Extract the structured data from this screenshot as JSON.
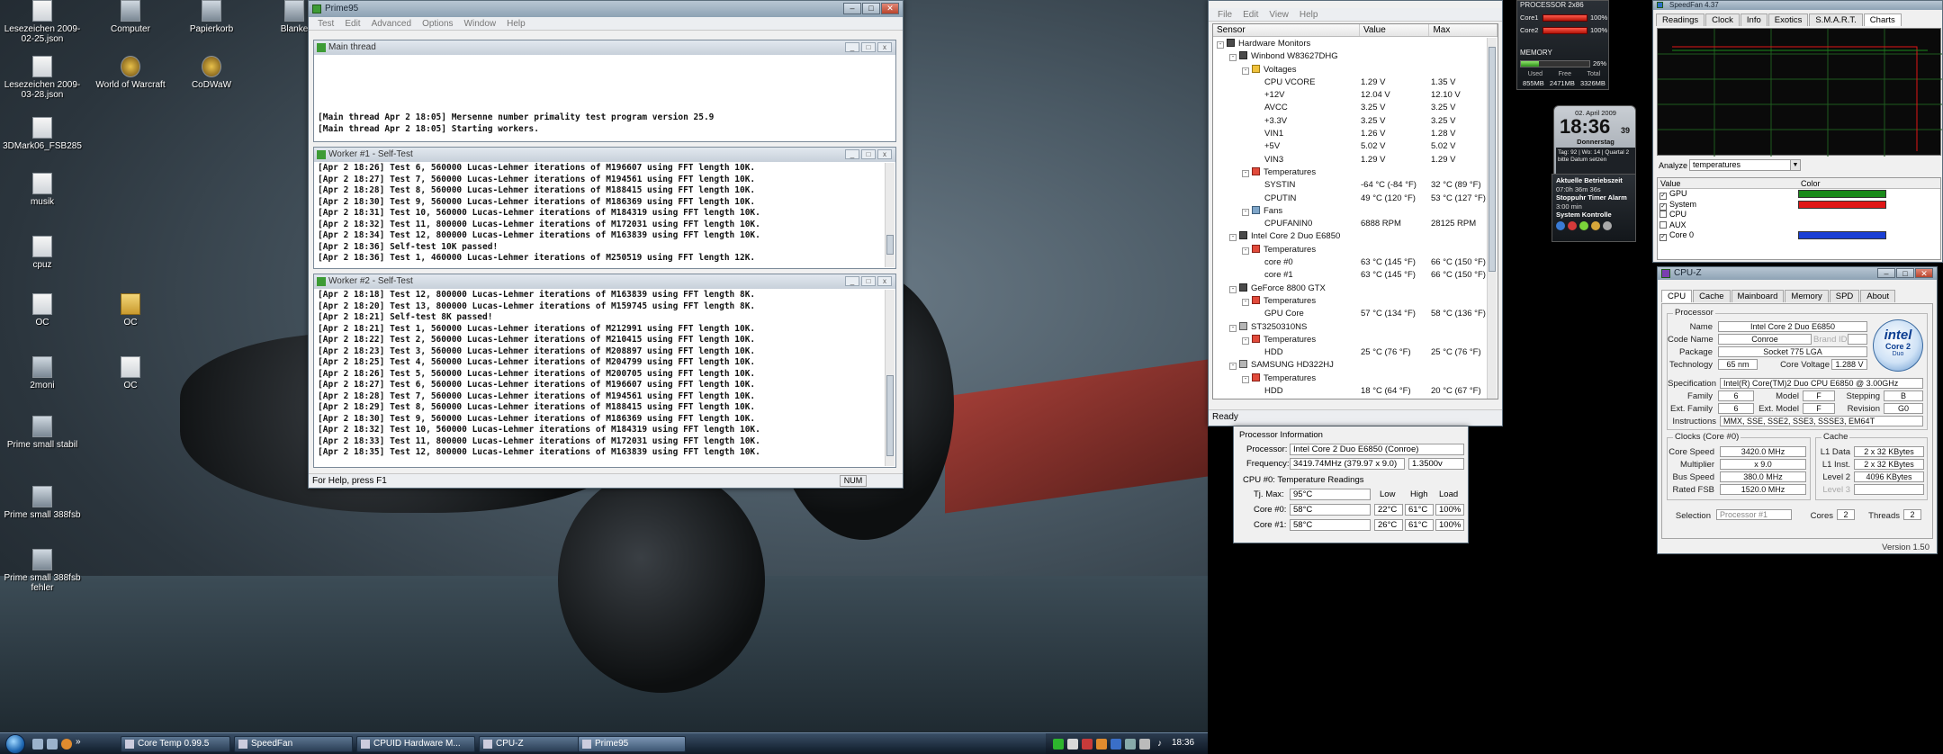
{
  "desktop": {
    "icons": [
      {
        "label": "Lesezeichen 2009-02-25.json",
        "kind": "doc"
      },
      {
        "label": "Computer",
        "kind": "prog"
      },
      {
        "label": "Papierkorb",
        "kind": "prog"
      },
      {
        "label": "Blanke",
        "kind": "prog"
      },
      {
        "label": "Lesezeichen 2009-03-28.json",
        "kind": "doc"
      },
      {
        "label": "World of Warcraft",
        "kind": "game"
      },
      {
        "label": "CoDWaW",
        "kind": "game"
      },
      {
        "label": "3DMark06_FSB285",
        "kind": "doc"
      },
      {
        "label": "musik",
        "kind": "doc"
      },
      {
        "label": "cpuz",
        "kind": "doc"
      },
      {
        "label": "OC",
        "kind": "doc"
      },
      {
        "label": "OC",
        "kind": "folder"
      },
      {
        "label": "2moni",
        "kind": "prog"
      },
      {
        "label": "OC",
        "kind": "doc"
      },
      {
        "label": "Prime small stabil",
        "kind": "prog"
      },
      {
        "label": "Prime small 388fsb",
        "kind": "prog"
      },
      {
        "label": "Prime small 388fsb fehler",
        "kind": "prog"
      }
    ]
  },
  "prime95": {
    "title": "Prime95",
    "menu": [
      "Test",
      "Edit",
      "Advanced",
      "Options",
      "Window",
      "Help"
    ],
    "status": "For Help, press F1",
    "num": "NUM",
    "main_thread": {
      "title": "Main thread",
      "lines": [
        "[Main thread Apr 2 18:05] Mersenne number primality test program version 25.9",
        "[Main thread Apr 2 18:05] Starting workers."
      ]
    },
    "worker1": {
      "title": "Worker #1 - Self-Test",
      "lines": [
        "[Apr 2 18:26] Test 6, 560000 Lucas-Lehmer iterations of M196607 using FFT length 10K.",
        "[Apr 2 18:27] Test 7, 560000 Lucas-Lehmer iterations of M194561 using FFT length 10K.",
        "[Apr 2 18:28] Test 8, 560000 Lucas-Lehmer iterations of M188415 using FFT length 10K.",
        "[Apr 2 18:30] Test 9, 560000 Lucas-Lehmer iterations of M186369 using FFT length 10K.",
        "[Apr 2 18:31] Test 10, 560000 Lucas-Lehmer iterations of M184319 using FFT length 10K.",
        "[Apr 2 18:32] Test 11, 800000 Lucas-Lehmer iterations of M172031 using FFT length 10K.",
        "[Apr 2 18:34] Test 12, 800000 Lucas-Lehmer iterations of M163839 using FFT length 10K.",
        "[Apr 2 18:36] Self-test 10K passed!",
        "[Apr 2 18:36] Test 1, 460000 Lucas-Lehmer iterations of M250519 using FFT length 12K."
      ]
    },
    "worker2": {
      "title": "Worker #2 - Self-Test",
      "lines": [
        "[Apr 2 18:18] Test 12, 800000 Lucas-Lehmer iterations of M163839 using FFT length 8K.",
        "[Apr 2 18:20] Test 13, 800000 Lucas-Lehmer iterations of M159745 using FFT length 8K.",
        "[Apr 2 18:21] Self-test 8K passed!",
        "[Apr 2 18:21] Test 1, 560000 Lucas-Lehmer iterations of M212991 using FFT length 10K.",
        "[Apr 2 18:22] Test 2, 560000 Lucas-Lehmer iterations of M210415 using FFT length 10K.",
        "[Apr 2 18:23] Test 3, 560000 Lucas-Lehmer iterations of M208897 using FFT length 10K.",
        "[Apr 2 18:25] Test 4, 560000 Lucas-Lehmer iterations of M204799 using FFT length 10K.",
        "[Apr 2 18:26] Test 5, 560000 Lucas-Lehmer iterations of M200705 using FFT length 10K.",
        "[Apr 2 18:27] Test 6, 560000 Lucas-Lehmer iterations of M196607 using FFT length 10K.",
        "[Apr 2 18:28] Test 7, 560000 Lucas-Lehmer iterations of M194561 using FFT length 10K.",
        "[Apr 2 18:29] Test 8, 560000 Lucas-Lehmer iterations of M188415 using FFT length 10K.",
        "[Apr 2 18:30] Test 9, 560000 Lucas-Lehmer iterations of M186369 using FFT length 10K.",
        "[Apr 2 18:32] Test 10, 560000 Lucas-Lehmer iterations of M184319 using FFT length 10K.",
        "[Apr 2 18:33] Test 11, 800000 Lucas-Lehmer iterations of M172031 using FFT length 10K.",
        "[Apr 2 18:35] Test 12, 800000 Lucas-Lehmer iterations of M163839 using FFT length 10K."
      ]
    }
  },
  "hwmonitor": {
    "menu": [
      "File",
      "Edit",
      "View",
      "Help"
    ],
    "columns": [
      "Sensor",
      "Value",
      "Max"
    ],
    "status": "Ready",
    "rows": [
      {
        "indent": 0,
        "label": "Hardware Monitors",
        "value": "",
        "max": "",
        "icon": "chip",
        "exp": "-"
      },
      {
        "indent": 1,
        "label": "Winbond W83627DHG",
        "value": "",
        "max": "",
        "icon": "chip",
        "exp": "-"
      },
      {
        "indent": 2,
        "label": "Voltages",
        "value": "",
        "max": "",
        "icon": "volt",
        "exp": "-"
      },
      {
        "indent": 3,
        "label": "CPU VCORE",
        "value": "1.29 V",
        "max": "1.35 V",
        "icon": "",
        "exp": ""
      },
      {
        "indent": 3,
        "label": "+12V",
        "value": "12.04 V",
        "max": "12.10 V",
        "icon": "",
        "exp": ""
      },
      {
        "indent": 3,
        "label": "AVCC",
        "value": "3.25 V",
        "max": "3.25 V",
        "icon": "",
        "exp": ""
      },
      {
        "indent": 3,
        "label": "+3.3V",
        "value": "3.25 V",
        "max": "3.25 V",
        "icon": "",
        "exp": ""
      },
      {
        "indent": 3,
        "label": "VIN1",
        "value": "1.26 V",
        "max": "1.28 V",
        "icon": "",
        "exp": ""
      },
      {
        "indent": 3,
        "label": "+5V",
        "value": "5.02 V",
        "max": "5.02 V",
        "icon": "",
        "exp": ""
      },
      {
        "indent": 3,
        "label": "VIN3",
        "value": "1.29 V",
        "max": "1.29 V",
        "icon": "",
        "exp": ""
      },
      {
        "indent": 2,
        "label": "Temperatures",
        "value": "",
        "max": "",
        "icon": "temp",
        "exp": "-"
      },
      {
        "indent": 3,
        "label": "SYSTIN",
        "value": "-64 °C (-84 °F)",
        "max": "32 °C (89 °F)",
        "icon": "",
        "exp": ""
      },
      {
        "indent": 3,
        "label": "CPUTIN",
        "value": "49 °C (120 °F)",
        "max": "53 °C (127 °F)",
        "icon": "",
        "exp": ""
      },
      {
        "indent": 2,
        "label": "Fans",
        "value": "",
        "max": "",
        "icon": "fan",
        "exp": "-"
      },
      {
        "indent": 3,
        "label": "CPUFANIN0",
        "value": "6888 RPM",
        "max": "28125 RPM",
        "icon": "",
        "exp": ""
      },
      {
        "indent": 1,
        "label": "Intel Core 2 Duo E6850",
        "value": "",
        "max": "",
        "icon": "chip",
        "exp": "-"
      },
      {
        "indent": 2,
        "label": "Temperatures",
        "value": "",
        "max": "",
        "icon": "temp",
        "exp": "-"
      },
      {
        "indent": 3,
        "label": "core #0",
        "value": "63 °C (145 °F)",
        "max": "66 °C (150 °F)",
        "icon": "",
        "exp": ""
      },
      {
        "indent": 3,
        "label": "core #1",
        "value": "63 °C (145 °F)",
        "max": "66 °C (150 °F)",
        "icon": "",
        "exp": ""
      },
      {
        "indent": 1,
        "label": "GeForce 8800 GTX",
        "value": "",
        "max": "",
        "icon": "chip",
        "exp": "-"
      },
      {
        "indent": 2,
        "label": "Temperatures",
        "value": "",
        "max": "",
        "icon": "temp",
        "exp": "-"
      },
      {
        "indent": 3,
        "label": "GPU Core",
        "value": "57 °C (134 °F)",
        "max": "58 °C (136 °F)",
        "icon": "",
        "exp": ""
      },
      {
        "indent": 1,
        "label": "ST3250310NS",
        "value": "",
        "max": "",
        "icon": "disk",
        "exp": "-"
      },
      {
        "indent": 2,
        "label": "Temperatures",
        "value": "",
        "max": "",
        "icon": "temp",
        "exp": "-"
      },
      {
        "indent": 3,
        "label": "HDD",
        "value": "25 °C (76 °F)",
        "max": "25 °C (76 °F)",
        "icon": "",
        "exp": ""
      },
      {
        "indent": 1,
        "label": "SAMSUNG HD322HJ",
        "value": "",
        "max": "",
        "icon": "disk",
        "exp": "-"
      },
      {
        "indent": 2,
        "label": "Temperatures",
        "value": "",
        "max": "",
        "icon": "temp",
        "exp": "-"
      },
      {
        "indent": 3,
        "label": "HDD",
        "value": "18 °C (64 °F)",
        "max": "20 °C (67 °F)",
        "icon": "",
        "exp": ""
      }
    ]
  },
  "coretemp": {
    "section_title": "Processor Information",
    "processor_label": "Processor:",
    "processor_value": "Intel Core 2 Duo E6850 (Conroe)",
    "frequency_label": "Frequency:",
    "frequency_value": "3419.74MHz (379.97 x 9.0)",
    "vid_value": "1.3500v",
    "readings_title": "CPU #0: Temperature Readings",
    "headers": [
      "Low",
      "High",
      "Load"
    ],
    "tjmax_label": "Tj. Max:",
    "tjmax_value": "95°C",
    "cores": [
      {
        "label": "Core #0:",
        "temp": "58°C",
        "low": "22°C",
        "high": "61°C",
        "load": "100%"
      },
      {
        "label": "Core #1:",
        "temp": "58°C",
        "low": "26°C",
        "high": "61°C",
        "load": "100%"
      }
    ]
  },
  "gadgets": {
    "cpu_title": "PROCESSOR 2x86",
    "cpu_cores": [
      {
        "label": "Core1",
        "value": "100%",
        "level": 1.0
      },
      {
        "label": "Core2",
        "value": "100%",
        "level": 1.0
      }
    ],
    "memory_title": "MEMORY",
    "memory_percent": "26%",
    "memory_level": 0.26,
    "memory_labels": [
      "Used",
      "Free",
      "Total"
    ],
    "memory_values": [
      "855MB",
      "2471MB",
      "3326MB"
    ],
    "clock_date": "02. April 2009",
    "clock_time": "18:36",
    "clock_seconds": "39",
    "clock_day": "Donnerstag",
    "clock_info": "Tag: 92 | Wo: 14 | Quartal 2",
    "clock_sub": "bitte Datum setzen",
    "uptime_title": "Aktuelle Betriebszeit",
    "uptime_value": "07:0h 36m 36s",
    "stopwatch_label": "Stoppuhr Timer Alarm",
    "timer_value": "3:00 min",
    "system_label": "System Kontrolle"
  },
  "speedfan": {
    "title": "SpeedFan 4.37",
    "tabs": [
      "Readings",
      "Clock",
      "Info",
      "Exotics",
      "S.M.A.R.T.",
      "Charts"
    ],
    "active_tab": "Charts",
    "analyze_label": "Analyze",
    "analyze_value": "temperatures",
    "list_headers": [
      "Value",
      "Color"
    ],
    "items": [
      {
        "label": "GPU",
        "checked": true,
        "color": "#1a8a1a"
      },
      {
        "label": "System",
        "checked": true,
        "color": "#e01616"
      },
      {
        "label": "CPU",
        "checked": false,
        "color": ""
      },
      {
        "label": "AUX",
        "checked": false,
        "color": ""
      },
      {
        "label": "Core 0",
        "checked": true,
        "color": "#1a3fd4"
      }
    ]
  },
  "cpuz": {
    "title": "CPU-Z",
    "tabs": [
      "CPU",
      "Cache",
      "Mainboard",
      "Memory",
      "SPD",
      "About"
    ],
    "processor_legend": "Processor",
    "name_label": "Name",
    "name_value": "Intel Core 2 Duo E6850",
    "codename_label": "Code Name",
    "codename_value": "Conroe",
    "brandid_label": "Brand ID",
    "package_label": "Package",
    "package_value": "Socket 775 LGA",
    "technology_label": "Technology",
    "technology_value": "65 nm",
    "corevoltage_label": "Core Voltage",
    "corevoltage_value": "1.288 V",
    "spec_label": "Specification",
    "spec_value": "Intel(R) Core(TM)2 Duo CPU    E6850  @ 3.00GHz",
    "family_label": "Family",
    "family_value": "6",
    "model_label": "Model",
    "model_value": "F",
    "stepping_label": "Stepping",
    "stepping_value": "B",
    "extfamily_label": "Ext. Family",
    "extfamily_value": "6",
    "extmodel_label": "Ext. Model",
    "extmodel_value": "F",
    "revision_label": "Revision",
    "revision_value": "G0",
    "instructions_label": "Instructions",
    "instructions_value": "MMX, SSE, SSE2, SSE3, SSSE3, EM64T",
    "clocks_legend": "Clocks (Core #0)",
    "corespeed_label": "Core Speed",
    "corespeed_value": "3420.0 MHz",
    "multiplier_label": "Multiplier",
    "multiplier_value": "x 9.0",
    "busspeed_label": "Bus Speed",
    "busspeed_value": "380.0 MHz",
    "ratedfsb_label": "Rated FSB",
    "ratedfsb_value": "1520.0 MHz",
    "cache_legend": "Cache",
    "l1data_label": "L1 Data",
    "l1data_value": "2 x 32 KBytes",
    "l1inst_label": "L1 Inst.",
    "l1inst_value": "2 x 32 KBytes",
    "level2_label": "Level 2",
    "level2_value": "4096 KBytes",
    "level3_label": "Level 3",
    "selection_label": "Selection",
    "selection_value": "Processor #1",
    "cores_label": "Cores",
    "cores_value": "2",
    "threads_label": "Threads",
    "threads_value": "2",
    "version": "Version 1.50",
    "logo_brand": "intel",
    "logo_line1": "Core 2",
    "logo_line2": "Duo"
  },
  "taskbar": {
    "buttons": [
      {
        "label": "Core Temp 0.99.5",
        "active": false
      },
      {
        "label": "SpeedFan",
        "active": false
      },
      {
        "label": "CPUID Hardware M...",
        "active": false
      },
      {
        "label": "CPU-Z",
        "active": false
      },
      {
        "label": "Prime95",
        "active": true
      }
    ],
    "clock": "18:36"
  }
}
